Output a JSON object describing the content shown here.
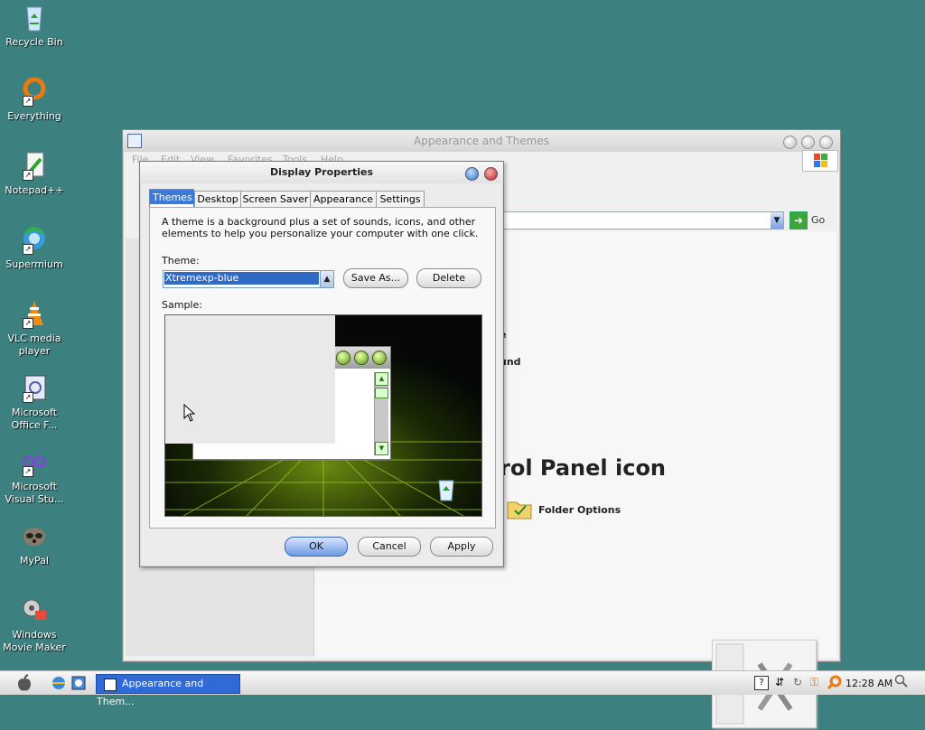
{
  "desktop": {
    "icons": [
      {
        "label": "Recycle Bin",
        "icon": "recycle-bin-icon"
      },
      {
        "label": "Everything",
        "icon": "everything-search-icon"
      },
      {
        "label": "Notepad++",
        "icon": "notepad-plus-icon"
      },
      {
        "label": "Supermium",
        "icon": "browser-icon"
      },
      {
        "label": "VLC media player",
        "icon": "vlc-cone-icon"
      },
      {
        "label": "Microsoft Office F...",
        "icon": "office-file-icon"
      },
      {
        "label": "Microsoft Visual Stu...",
        "icon": "visual-studio-icon"
      },
      {
        "label": "MyPal",
        "icon": "raccoon-icon"
      },
      {
        "label": "Windows Movie Maker",
        "icon": "movie-maker-icon"
      }
    ]
  },
  "background_window": {
    "title": "Appearance and Themes",
    "menu": [
      "File",
      "Edit",
      "View",
      "Favorites",
      "Tools",
      "Help"
    ],
    "go_label": "Go",
    "partial_text": {
      "text_1": "e",
      "text_2": "und",
      "heading": "rol Panel icon",
      "folder_options": "Folder Options"
    }
  },
  "dialog": {
    "title": "Display Properties",
    "tabs": [
      "Themes",
      "Desktop",
      "Screen Saver",
      "Appearance",
      "Settings"
    ],
    "description": "A theme is a background plus a set of sounds, icons, and other elements to help you personalize your computer with one click.",
    "theme_label": "Theme:",
    "theme_value": "Xtremexp-blue",
    "save_as": "Save As...",
    "delete": "Delete",
    "sample_label": "Sample:",
    "ok": "OK",
    "cancel": "Cancel",
    "apply": "Apply"
  },
  "taskbar": {
    "task_label": "Appearance and Them...",
    "clock": "12:28 AM"
  }
}
